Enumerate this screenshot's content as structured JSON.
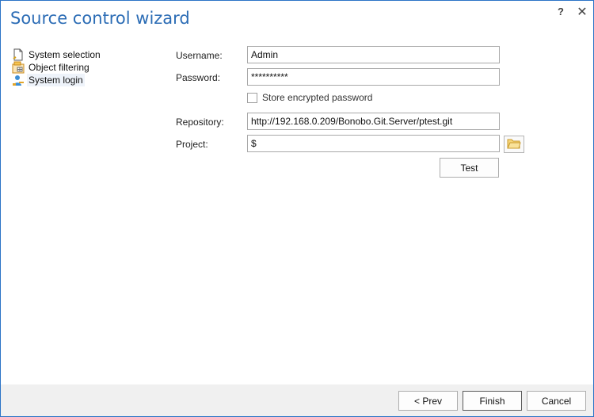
{
  "window": {
    "title": "Source control wizard",
    "help_label": "?",
    "close_label": "✕"
  },
  "nav": {
    "items": [
      {
        "label": "System selection",
        "icon": "document-icon"
      },
      {
        "label": "Object filtering",
        "icon": "filter-table-icon"
      },
      {
        "label": "System login",
        "icon": "user-login-icon",
        "selected": true
      }
    ]
  },
  "form": {
    "username_label": "Username:",
    "username_value": "Admin",
    "password_label": "Password:",
    "password_value": "**********",
    "store_password_label": "Store encrypted password",
    "store_password_checked": false,
    "repository_label": "Repository:",
    "repository_value": "http://192.168.0.209/Bonobo.Git.Server/ptest.git",
    "project_label": "Project:",
    "project_value": "$",
    "test_label": "Test"
  },
  "footer": {
    "prev_label": "< Prev",
    "finish_label": "Finish",
    "cancel_label": "Cancel"
  },
  "colors": {
    "title": "#2b6cb5",
    "border": "#2b74c7",
    "footer_bg": "#f0f0f0"
  }
}
